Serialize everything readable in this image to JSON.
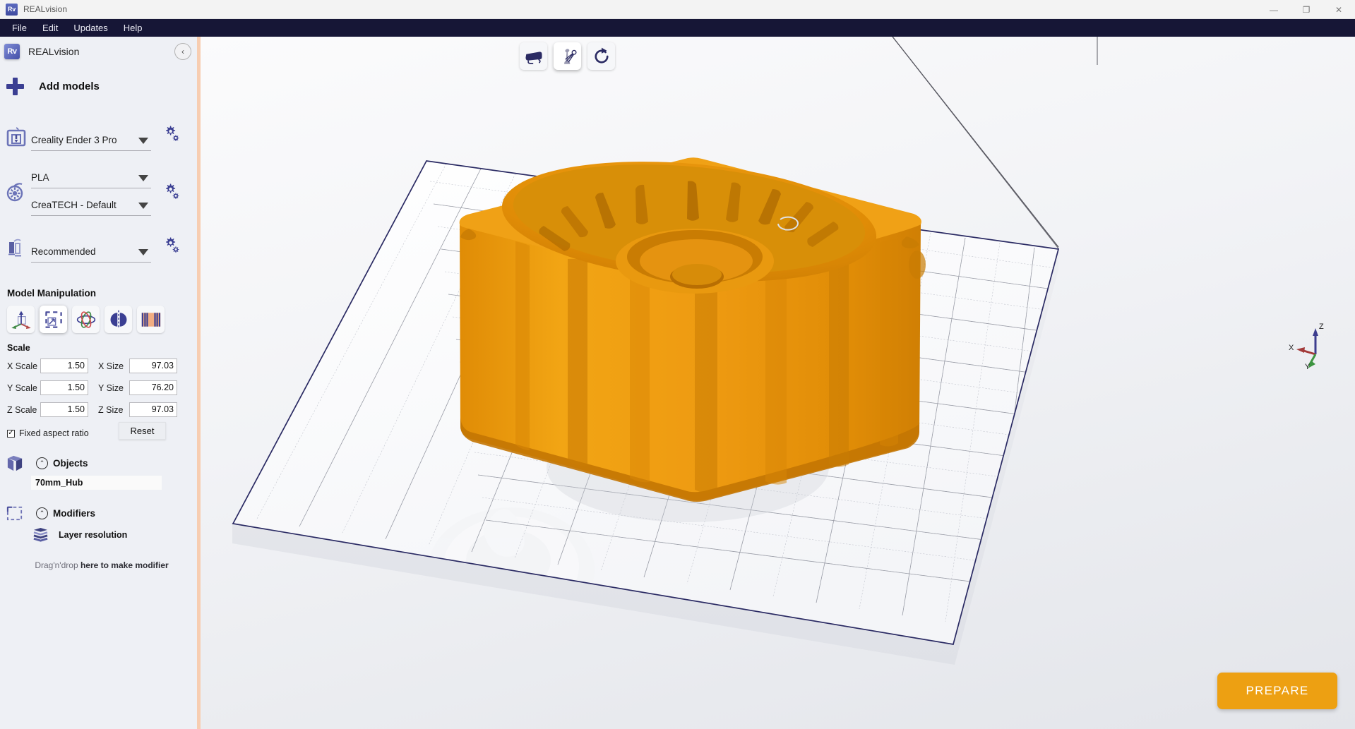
{
  "window": {
    "app_icon": "Rv",
    "title": "REALvision",
    "controls": [
      {
        "name": "minimize",
        "glyph": "—"
      },
      {
        "name": "maximize",
        "glyph": "❐"
      },
      {
        "name": "close",
        "glyph": "✕"
      }
    ]
  },
  "menubar": {
    "items": [
      "File",
      "Edit",
      "Updates",
      "Help"
    ]
  },
  "sidebar": {
    "app_icon": "Rv",
    "app_name": "REALvision",
    "collapse_glyph": "‹",
    "add_models_label": "Add models",
    "selectors": [
      {
        "icon": "printer-icon",
        "value": "Creality Ender 3 Pro",
        "has_gear": true
      },
      {
        "icon": "filament-icon",
        "value": "PLA",
        "has_gear": true
      },
      {
        "icon": "filament-icon",
        "value": "CreaTECH - Default",
        "has_gear": false
      },
      {
        "icon": "support-icon",
        "value": "Recommended",
        "has_gear": true
      }
    ],
    "model_manipulation": {
      "title": "Model Manipulation",
      "tools": [
        {
          "name": "move-tool",
          "active": false
        },
        {
          "name": "scale-tool",
          "active": true
        },
        {
          "name": "rotate-tool",
          "active": false
        },
        {
          "name": "mirror-tool",
          "active": false
        },
        {
          "name": "support-blocker-tool",
          "active": false
        }
      ]
    },
    "scale": {
      "title": "Scale",
      "rows": [
        {
          "scale_label": "X Scale",
          "scale_value": "1.50",
          "size_label": "X Size",
          "size_value": "97.03"
        },
        {
          "scale_label": "Y Scale",
          "scale_value": "1.50",
          "size_label": "Y Size",
          "size_value": "76.20"
        },
        {
          "scale_label": "Z Scale",
          "scale_value": "1.50",
          "size_label": "Z Size",
          "size_value": "97.03"
        }
      ],
      "fixed_aspect_label": "Fixed aspect ratio",
      "fixed_aspect_checked": "✓",
      "reset_label": "Reset"
    },
    "objects": {
      "label": "Objects",
      "collapse_glyph": "⌃",
      "items": [
        "70mm_Hub"
      ]
    },
    "modifiers": {
      "label": "Modifiers",
      "collapse_glyph": "⌃",
      "items": [
        "Layer resolution"
      ],
      "dropzone_prefix": "Drag'n'drop ",
      "dropzone_bold": "here to make modifier"
    }
  },
  "viewport": {
    "tools": [
      {
        "name": "view-camera-icon",
        "selected": false
      },
      {
        "name": "lighting-perspective-icon",
        "selected": true
      },
      {
        "name": "reset-rotation-icon",
        "selected": false
      }
    ],
    "axis_labels": {
      "x": "X",
      "y": "Y",
      "z": "Z"
    },
    "axis_colors": {
      "x": "#a33a3a",
      "y": "#3d9440",
      "z": "#3c3c8e"
    },
    "model": {
      "name": "70mm_Hub",
      "color": "#ee9a11",
      "shadow_color": "#cf8209"
    },
    "buildplate_outline_color": "#2a2a63",
    "prepare_label": "PREPARE",
    "prepare_color": "#eda012"
  }
}
